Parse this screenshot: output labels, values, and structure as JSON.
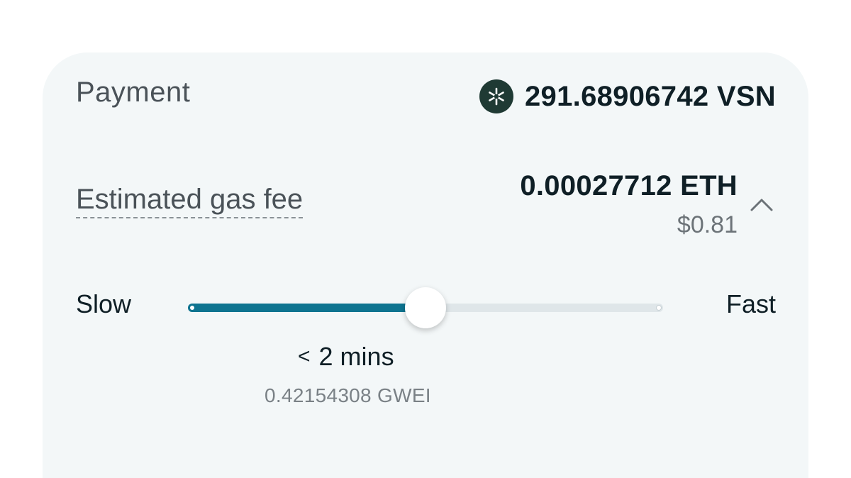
{
  "payment": {
    "label": "Payment",
    "token_icon": "vsn-token-icon",
    "amount": "291.68906742 VSN"
  },
  "gas_fee": {
    "label": "Estimated gas fee",
    "eth_value": "0.00027712 ETH",
    "usd_value": "$0.81",
    "toggle_icon": "chevron-up-icon"
  },
  "speed": {
    "slow_label": "Slow",
    "fast_label": "Fast",
    "slider_value_fraction": 0.5,
    "eta_prefix": "<",
    "eta_text": "2 mins",
    "gwei": "0.42154308 GWEI"
  },
  "colors": {
    "accent": "#0e7490",
    "card_background": "#f3f7f8",
    "token_icon_bg": "#1f3a34"
  }
}
